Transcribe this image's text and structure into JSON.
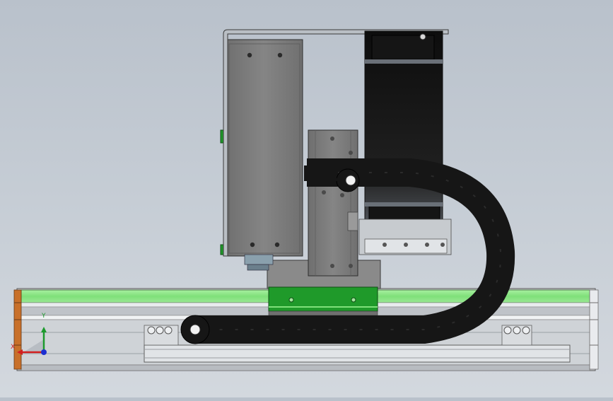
{
  "viewport": {
    "background_top": "#b9c1cb",
    "background_bottom": "#d3d8de"
  },
  "triad": {
    "x_label": "X",
    "y_label": "Y",
    "x_color": "#d21f1f",
    "y_color": "#1c9a2c",
    "z_color": "#1d2fd0"
  },
  "colors": {
    "rail_green": "#7fe07a",
    "carriage_green": "#1f9a2a",
    "chain_black": "#1a1a1a",
    "plate_grey": "#7d7d7d",
    "end_cap_orange": "#c8702a",
    "profile_silver": "#d4d7da"
  }
}
